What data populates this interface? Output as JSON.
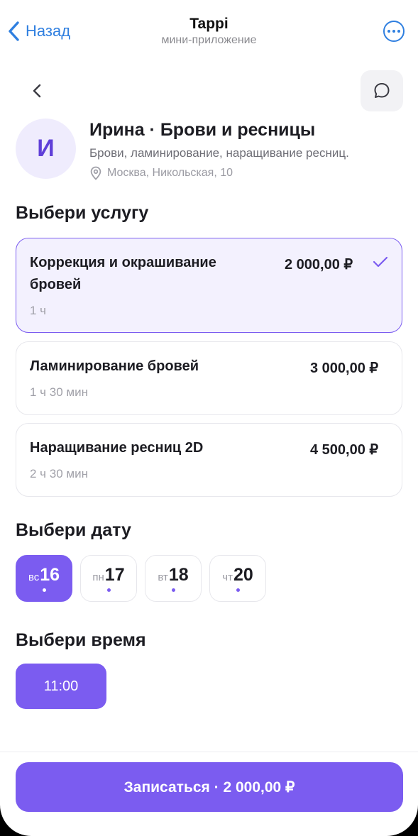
{
  "telegram_bar": {
    "back_label": "Назад",
    "title": "Tappi",
    "subtitle": "мини-приложение",
    "link_color": "#2f7fe0"
  },
  "master": {
    "avatar_letter": "И",
    "name": "Ирина · Брови и ресницы",
    "description": "Брови, ламинирование, наращивание ресниц.",
    "address": "Москва, Никольская, 10"
  },
  "services_section": {
    "title": "Выбери услугу",
    "items": [
      {
        "name": "Коррекция и окрашивание бровей",
        "price": "2 000,00 ₽",
        "duration": "1 ч",
        "selected": true
      },
      {
        "name": "Ламинирование бровей",
        "price": "3 000,00 ₽",
        "duration": "1 ч 30 мин",
        "selected": false
      },
      {
        "name": "Наращивание ресниц 2D",
        "price": "4 500,00 ₽",
        "duration": "2 ч 30 мин",
        "selected": false
      }
    ]
  },
  "date_section": {
    "title": "Выбери дату",
    "dates": [
      {
        "dow": "вс",
        "day": "16",
        "selected": true
      },
      {
        "dow": "пн",
        "day": "17",
        "selected": false
      },
      {
        "dow": "вт",
        "day": "18",
        "selected": false
      },
      {
        "dow": "чт",
        "day": "20",
        "selected": false
      }
    ]
  },
  "time_section": {
    "title": "Выбери время",
    "slots": [
      {
        "time": "11:00",
        "selected": true
      }
    ]
  },
  "cta": {
    "label": "Записаться · 2 000,00 ₽"
  },
  "colors": {
    "accent": "#7b5cf0",
    "selected_bg": "#f3f1fe",
    "avatar_bg": "#efecfd"
  },
  "icons": {
    "back": "chevron-left-icon",
    "chat": "chat-bubble-icon",
    "location": "location-pin-icon",
    "check": "check-icon",
    "more": "more-horizontal-icon"
  }
}
